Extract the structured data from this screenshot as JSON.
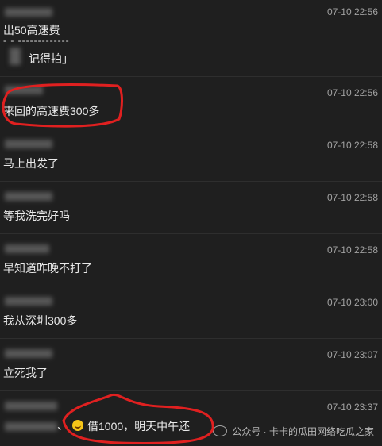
{
  "messages": [
    {
      "time": "07-10 22:56",
      "text": "出50高速费",
      "dash": "- - -------------",
      "quote": "记得拍」"
    },
    {
      "time": "07-10 22:56",
      "text": "来回的高速费300多"
    },
    {
      "time": "07-10 22:58",
      "text": "马上出发了"
    },
    {
      "time": "07-10 22:58",
      "text": "等我洗完好吗"
    },
    {
      "time": "07-10 22:58",
      "text": "早知道咋晚不打了"
    },
    {
      "time": "07-10 23:00",
      "text": "我从深圳300多"
    },
    {
      "time": "07-10 23:07",
      "text": "立死我了"
    },
    {
      "time": "07-10 23:37",
      "prefix": "、",
      "text": "借1000，明天中午还",
      "emoji": "laughing-face"
    }
  ],
  "watermark": {
    "text": "公众号 · 卡卡的瓜田网络吃瓜之家",
    "icon": "wechat-icon"
  },
  "colors": {
    "background": "#1f1f1f",
    "annotation": "#e02020"
  }
}
